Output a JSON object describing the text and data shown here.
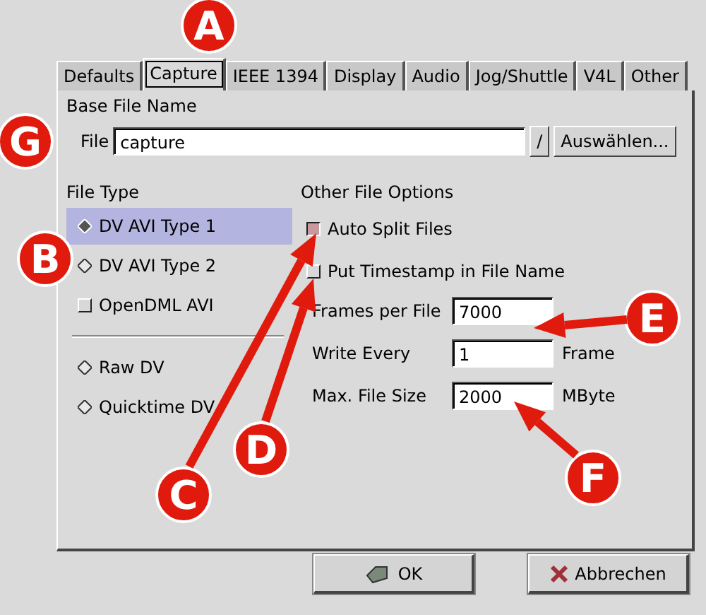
{
  "tabs": [
    {
      "label": "Defaults",
      "selected": false
    },
    {
      "label": "Capture",
      "selected": true
    },
    {
      "label": "IEEE 1394",
      "selected": false
    },
    {
      "label": "Display",
      "selected": false
    },
    {
      "label": "Audio",
      "selected": false
    },
    {
      "label": "Jog/Shuttle",
      "selected": false
    },
    {
      "label": "V4L",
      "selected": false
    },
    {
      "label": "Other",
      "selected": false
    }
  ],
  "base_file_name": {
    "heading": "Base File Name",
    "file_label": "File",
    "value": "capture",
    "dropdown": "/",
    "browse_button": "Auswählen..."
  },
  "file_type": {
    "heading": "File Type",
    "options": [
      {
        "label": "DV AVI Type 1",
        "kind": "radio",
        "selected": true
      },
      {
        "label": "DV AVI Type 2",
        "kind": "radio",
        "selected": false
      },
      {
        "label": "OpenDML AVI",
        "kind": "checkbox",
        "checked": false
      }
    ],
    "formats": [
      {
        "label": "Raw DV",
        "selected": false
      },
      {
        "label": "Quicktime DV",
        "selected": false
      }
    ]
  },
  "other_file_options": {
    "heading": "Other File Options",
    "checkboxes": [
      {
        "label": "Auto Split Files",
        "checked": true
      },
      {
        "label": "Put Timestamp in File Name",
        "checked": false
      }
    ],
    "fields": [
      {
        "label": "Frames per File",
        "value": "7000"
      },
      {
        "label": "Write Every",
        "value": "1",
        "unit": "Frame"
      },
      {
        "label": "Max. File Size",
        "value": "2000",
        "unit": "MByte"
      }
    ]
  },
  "buttons": [
    {
      "label": "OK",
      "kind": "ok"
    },
    {
      "label": "Abbrechen",
      "kind": "cancel"
    }
  ],
  "annotations": [
    {
      "label": "A"
    },
    {
      "label": "G"
    },
    {
      "label": "B"
    },
    {
      "label": "E"
    },
    {
      "label": "D"
    },
    {
      "label": "F"
    },
    {
      "label": "C"
    }
  ]
}
